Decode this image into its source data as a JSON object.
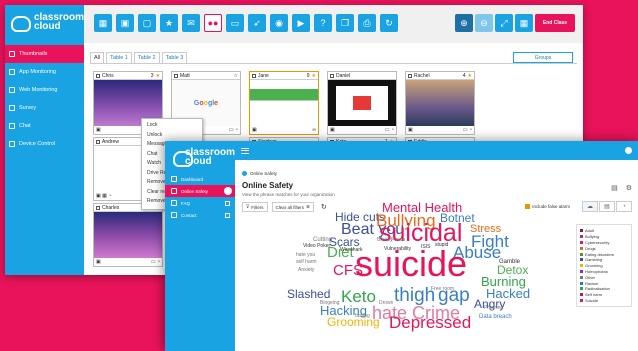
{
  "back_window": {
    "logo_line1": "classroom",
    "logo_line2": "cloud",
    "nav": [
      "Thumbnails",
      "App Monitoring",
      "Web Monitoring",
      "Survey",
      "Chat",
      "Device Control"
    ],
    "end_class_label": "End Class",
    "tabs": [
      "All",
      "Table 1",
      "Table 2",
      "Table 3"
    ],
    "groups_label": "Groups",
    "thumbnails": [
      {
        "name": "Chris",
        "count": "3",
        "foot_left": "",
        "foot_right": ""
      },
      {
        "name": "Matt",
        "count": "",
        "foot_left": "",
        "foot_right": ""
      },
      {
        "name": "Jane",
        "count": "9",
        "foot_left": "",
        "foot_right": "∞"
      },
      {
        "name": "Daniel",
        "count": "",
        "foot_left": "",
        "foot_right": ""
      },
      {
        "name": "Rachel",
        "count": "4",
        "foot_left": "",
        "foot_right": ""
      },
      {
        "name": "Andrew",
        "count": "",
        "foot_left": "",
        "foot_right": ""
      },
      {
        "name": "Stephen",
        "count": "",
        "foot_left": "",
        "foot_right": ""
      },
      {
        "name": "Kate",
        "count": "1",
        "foot_left": "",
        "foot_right": ""
      },
      {
        "name": "Eddie",
        "count": "",
        "foot_left": "",
        "foot_right": ""
      },
      {
        "name": "Charles",
        "count": "",
        "foot_left": "",
        "foot_right": ""
      }
    ],
    "context_menu": [
      "Lock",
      "Unlock",
      "Message",
      "Chat",
      "Watch",
      "Drive Remote",
      "Remove fro",
      "Clear reser",
      "Remove"
    ]
  },
  "front_window": {
    "logo_line1": "classroom",
    "logo_line2": "cloud",
    "nav": [
      "Dashboard",
      "Online Safety",
      "FAQ",
      "Contact"
    ],
    "breadcrumb": "Online Safety",
    "title": "Online Safety",
    "subtitle": "View the phrase matches for your organization",
    "filters_label": "Filters",
    "clear_filters_label": "Clear all filters",
    "include_false_alarm": "Include false alarm",
    "legend": [
      {
        "label": "Adult",
        "color": "#8b1a3a"
      },
      {
        "label": "Bullying",
        "color": "#b22b8a"
      },
      {
        "label": "Cybersecurity",
        "color": "#e8135a"
      },
      {
        "label": "Drugs",
        "color": "#e96a1f"
      },
      {
        "label": "Eating disorders",
        "color": "#5a8f2a"
      },
      {
        "label": "Gambling",
        "color": "#3a4fa0"
      },
      {
        "label": "Grooming",
        "color": "#f2b300"
      },
      {
        "label": "Homophobia",
        "color": "#9c27b0"
      },
      {
        "label": "Other",
        "color": "#777777"
      },
      {
        "label": "Racism",
        "color": "#1a7fc1"
      },
      {
        "label": "Radicalisation",
        "color": "#2ea84a"
      },
      {
        "label": "Self harm",
        "color": "#c2185b"
      },
      {
        "label": "Suicide",
        "color": "#d81b60"
      }
    ],
    "word_cloud": [
      {
        "text": "Mental Health",
        "color": "#e8135a",
        "size": 13
      },
      {
        "text": "Hide cuts",
        "color": "#3a4fa0",
        "size": 12
      },
      {
        "text": "Bullying",
        "color": "#e96a1f",
        "size": 17
      },
      {
        "text": "Botnet",
        "color": "#3a7fc1",
        "size": 12
      },
      {
        "text": "Beat you",
        "color": "#3a4fa0",
        "size": 16
      },
      {
        "text": "suicidal",
        "color": "#e8135a",
        "size": 25
      },
      {
        "text": "Stress",
        "color": "#e96a1f",
        "size": 11
      },
      {
        "text": "Fight",
        "color": "#3a7fc1",
        "size": 17
      },
      {
        "text": "Cutting",
        "color": "#777777",
        "size": 6
      },
      {
        "text": "Scars",
        "color": "#3a4fa0",
        "size": 12
      },
      {
        "text": "Diet",
        "color": "#4caf50",
        "size": 15
      },
      {
        "text": "Breezy",
        "color": "#777777",
        "size": 5
      },
      {
        "text": "Punch",
        "color": "#777777",
        "size": 5
      },
      {
        "text": "Abuse",
        "color": "#3a7fc1",
        "size": 17
      },
      {
        "text": "Video Poker",
        "color": "#333333",
        "size": 5
      },
      {
        "text": "Wireshark",
        "color": "#333333",
        "size": 5
      },
      {
        "text": "Vulnerability",
        "color": "#333333",
        "size": 5
      },
      {
        "text": "ISIS",
        "color": "#333333",
        "size": 5
      },
      {
        "text": "stupid",
        "color": "#333333",
        "size": 5
      },
      {
        "text": "Gamble",
        "color": "#333333",
        "size": 6
      },
      {
        "text": "hate you",
        "color": "#777777",
        "size": 5
      },
      {
        "text": "CFS",
        "color": "#e8135a",
        "size": 15
      },
      {
        "text": "suicide",
        "color": "#e8135a",
        "size": 36
      },
      {
        "text": "Detox",
        "color": "#4caf50",
        "size": 12
      },
      {
        "text": "self harm",
        "color": "#777777",
        "size": 5
      },
      {
        "text": "Burning",
        "color": "#2ea84a",
        "size": 13
      },
      {
        "text": "Anxiety",
        "color": "#777777",
        "size": 5
      },
      {
        "text": "Free room",
        "color": "#777777",
        "size": 5
      },
      {
        "text": "Slashed",
        "color": "#3a4fa0",
        "size": 12
      },
      {
        "text": "Keto",
        "color": "#2ea84a",
        "size": 17
      },
      {
        "text": "thigh",
        "color": "#3a7fc1",
        "size": 19
      },
      {
        "text": "gap",
        "color": "#3a7fc1",
        "size": 19
      },
      {
        "text": "Hacked",
        "color": "#3a7fc1",
        "size": 13
      },
      {
        "text": "Bingeing",
        "color": "#777777",
        "size": 5
      },
      {
        "text": "Angry",
        "color": "#3a4fa0",
        "size": 12
      },
      {
        "text": "Hacking",
        "color": "#3a7fc1",
        "size": 13
      },
      {
        "text": "Drown",
        "color": "#777777",
        "size": 5
      },
      {
        "text": "Phishing",
        "color": "#777777",
        "size": 5
      },
      {
        "text": "fasting",
        "color": "#777777",
        "size": 5
      },
      {
        "text": "hate Crime",
        "color": "#e57aa0",
        "size": 18
      },
      {
        "text": "Data breach",
        "color": "#3a7fc1",
        "size": 6
      },
      {
        "text": "Grooming",
        "color": "#f2b300",
        "size": 12
      },
      {
        "text": "Depressed",
        "color": "#e8135a",
        "size": 17
      }
    ]
  }
}
